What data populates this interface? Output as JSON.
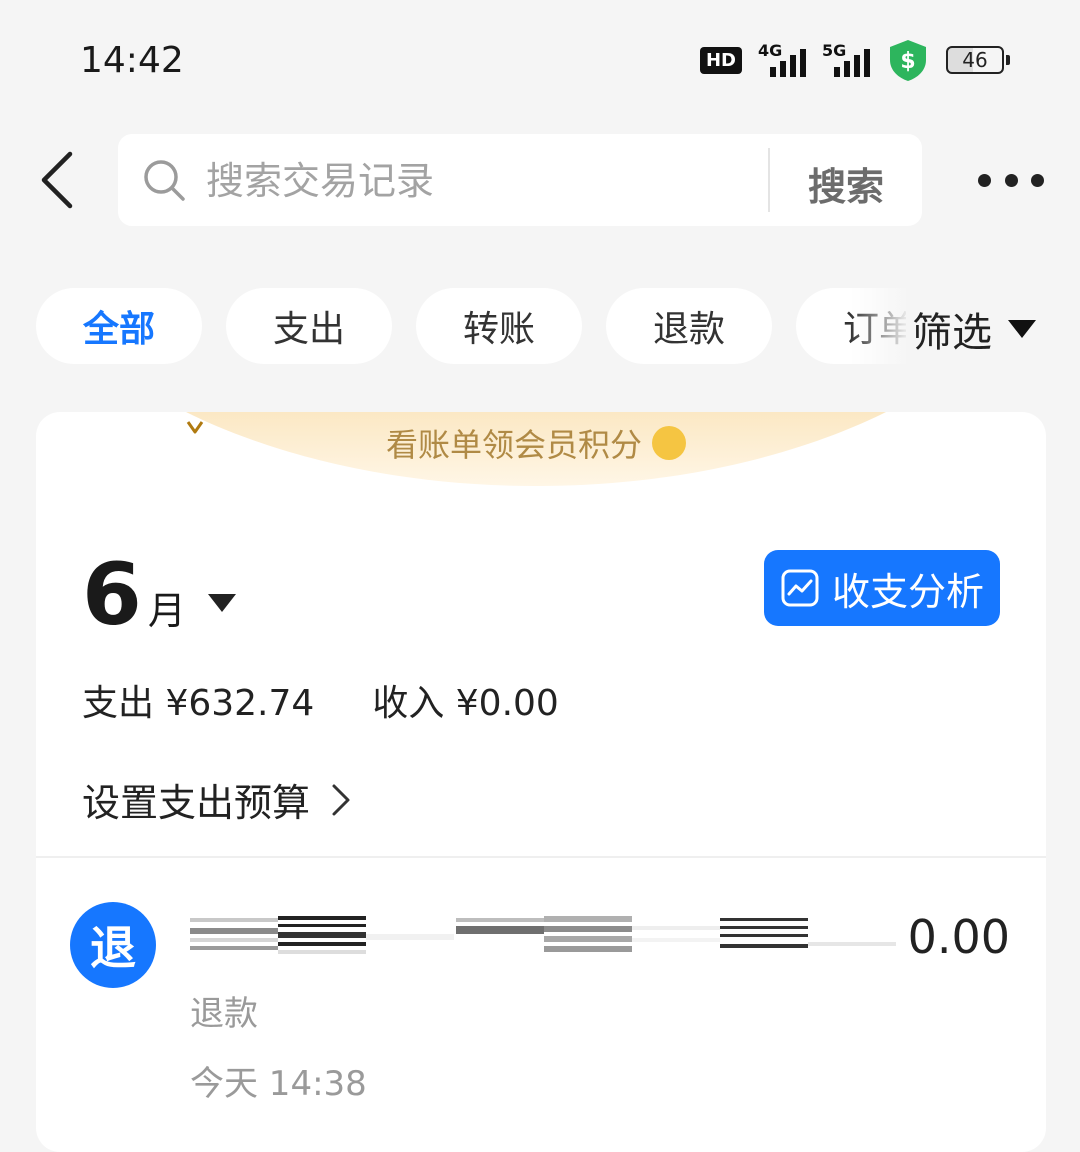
{
  "status_bar": {
    "time": "14:42",
    "hd_label": "HD",
    "net1": "4G",
    "net2": "5G",
    "battery": "46",
    "shield_icon": "dollar-shield-icon"
  },
  "header": {
    "back_icon": "chevron-left-icon",
    "search_placeholder": "搜索交易记录",
    "search_button": "搜索",
    "more_icon": "more-horizontal-icon"
  },
  "tabs": [
    {
      "label": "全部",
      "active": true
    },
    {
      "label": "支出",
      "active": false
    },
    {
      "label": "转账",
      "active": false
    },
    {
      "label": "退款",
      "active": false
    },
    {
      "label": "订单",
      "active": false
    }
  ],
  "filter_label": "筛选",
  "banner_text": "看账单领会员积分",
  "month": {
    "number": "6",
    "unit": "月"
  },
  "analysis_button": "收支分析",
  "summary": {
    "expense": "支出 ¥632.74",
    "income": "收入 ¥0.00"
  },
  "budget_link": "设置支出预算",
  "transaction": {
    "icon_char": "退",
    "amount": "0.00",
    "type": "退款",
    "time": "今天 14:38"
  },
  "colors": {
    "accent": "#1677ff",
    "banner_text": "#b08a45",
    "shield": "#2db55d"
  }
}
